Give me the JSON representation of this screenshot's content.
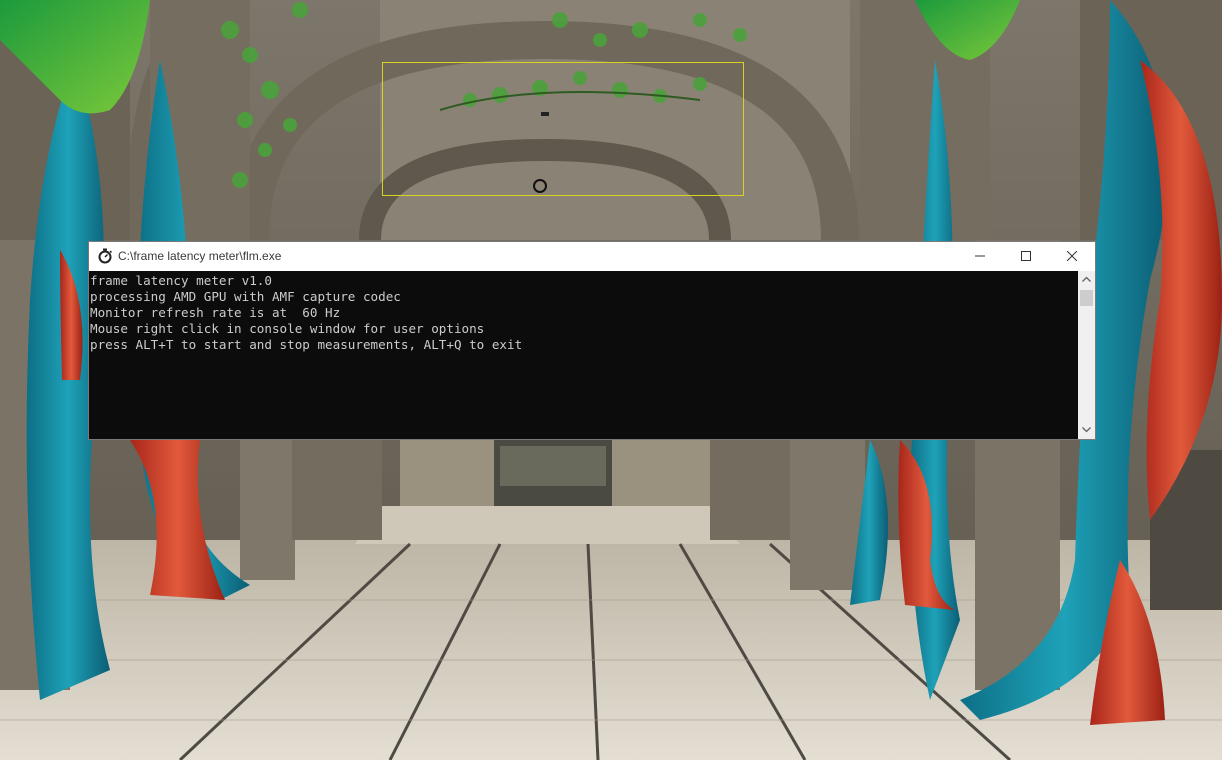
{
  "window": {
    "title": "C:\\frame latency meter\\flm.exe"
  },
  "console": {
    "lines": [
      "frame latency meter v1.0",
      "processing AMD GPU with AMF capture codec",
      "Monitor refresh rate is at  60 Hz",
      "Mouse right click in console window for user options",
      "press ALT+T to start and stop measurements, ALT+Q to exit"
    ],
    "text_color": "#cccccc",
    "background_color": "#0c0c0c"
  },
  "icons": {
    "app_icon": "stopwatch-icon",
    "minimize": "minimize-icon",
    "maximize": "maximize-icon",
    "close": "close-icon",
    "scroll_up": "chevron-up-icon",
    "scroll_down": "chevron-down-icon"
  },
  "overlay": {
    "selection_box_color": "#d9d320"
  }
}
